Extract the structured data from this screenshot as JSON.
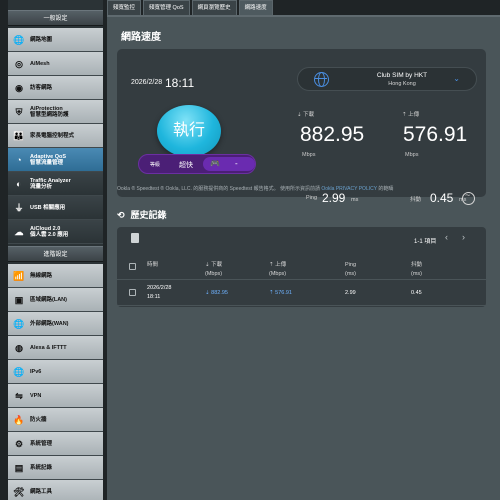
{
  "tabs": [
    "頻寬監控",
    "頻寬管理 QoS",
    "網頁瀏覽歷史",
    "網路速度"
  ],
  "sidebar": {
    "general_header": "一般設定",
    "general_items": [
      {
        "line1": "網路地圖",
        "line2": ""
      },
      {
        "line1": "AiMesh",
        "line2": ""
      },
      {
        "line1": "訪客網路",
        "line2": ""
      },
      {
        "line1": "AiProtection",
        "line2": "智慧型網路防護"
      },
      {
        "line1": "家長電腦控制程式",
        "line2": ""
      },
      {
        "line1": "Adaptive QoS",
        "line2": "智慧流量管理"
      },
      {
        "line1": "Traffic Analyzer",
        "line2": "流量分析"
      },
      {
        "line1": "USB 相關應用",
        "line2": ""
      },
      {
        "line1": "AiCloud 2.0",
        "line2": "個人雲 2.0 應用"
      }
    ],
    "advanced_header": "進階設定",
    "advanced_items": [
      "無線網路",
      "區域網路(LAN)",
      "外部網路(WAN)",
      "Alexa & IFTTT",
      "IPv6",
      "VPN",
      "防火牆",
      "系統管理",
      "系統記錄",
      "網路工具"
    ]
  },
  "main": {
    "title": "網路速度",
    "date": "2026/2/28",
    "time": "18:11",
    "server_name": "Club SIM by HKT",
    "server_location": "Hong Kong",
    "go_label": "執行",
    "download_caption": "下載",
    "download_value": "882.95",
    "upload_caption": "上傳",
    "upload_value": "576.91",
    "unit": "Mbps",
    "type_label": "等級",
    "type_value": "超快",
    "type_dash": "-",
    "ping_label": "Ping",
    "ping_value": "2.99",
    "jitter_label": "抖動",
    "jitter_value": "0.45",
    "ms": "ms",
    "disclaimer": "Ookla ® Speedtest ® Ookla, LLC. 的服務提供商的 Speedtest 報告格式。",
    "disclaimer_link": "Ookla PRIVACY POLICY",
    "disclaimer_end": "的範疇",
    "disclaimer_prefix": "使用所示資訊前請",
    "history_title": "歷史記錄",
    "page_info": "1-1 項目",
    "columns": [
      {
        "l1": "時間",
        "l2": ""
      },
      {
        "l1": "下載",
        "l2": "(Mbps)"
      },
      {
        "l1": "上傳",
        "l2": "(Mbps)"
      },
      {
        "l1": "Ping",
        "l2": "(ms)"
      },
      {
        "l1": "抖動",
        "l2": "(ms)"
      }
    ],
    "row": {
      "date": "2026/2/28",
      "time": "18:11",
      "download": "882.95",
      "upload": "576.91",
      "ping": "2.99",
      "jitter": "0.45"
    }
  }
}
